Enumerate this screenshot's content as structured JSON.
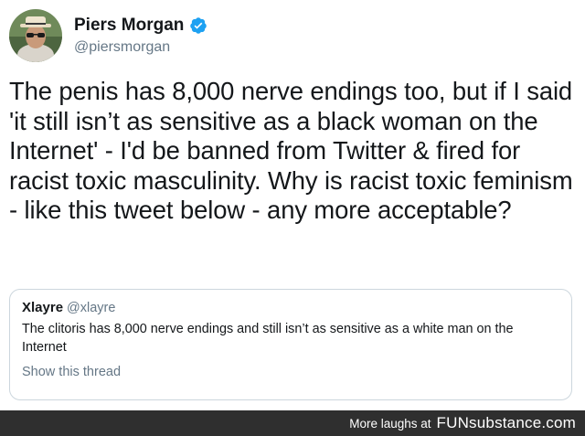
{
  "author": {
    "display_name": "Piers Morgan",
    "handle": "@piersmorgan",
    "verified_icon": "verified-badge-icon",
    "avatar_icon": "profile-photo"
  },
  "tweet": {
    "text": "The penis has 8,000 nerve endings too, but if I said 'it still isn’t as sensitive as a black woman on the Internet' - I'd be banned from Twitter & fired for racist toxic masculinity. Why is racist toxic feminism - like this tweet below - any more acceptable?"
  },
  "quoted_tweet": {
    "display_name": "Xlayre",
    "handle": "@xlayre",
    "text": "The clitoris has 8,000 nerve endings and still isn’t as sensitive as a white man on the Internet",
    "show_thread_label": "Show this thread"
  },
  "footer": {
    "more_laughs": "More laughs at",
    "brand": "FUNsubstance.com"
  },
  "colors": {
    "text_primary": "#14171a",
    "text_secondary": "#657786",
    "verified_blue": "#1da1f2",
    "border": "#ccd6dd",
    "footer_bg": "#2f2f2f"
  }
}
